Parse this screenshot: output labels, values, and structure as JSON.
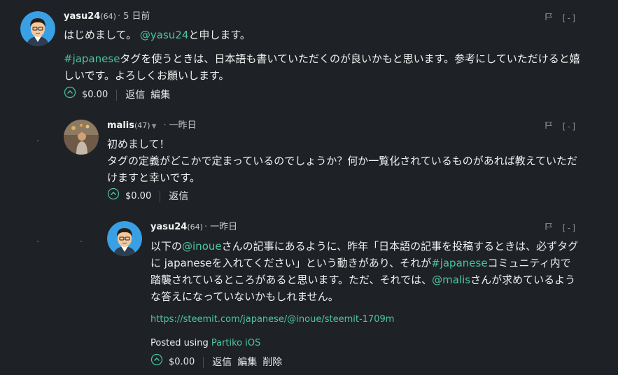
{
  "comments": [
    {
      "author": "yasu24",
      "reputation": "(64)",
      "separator": "·",
      "time": "5 日前",
      "collapse": "[-]",
      "body": {
        "greeting_text": "はじめまして。",
        "mention": "@yasu24",
        "greeting_suffix": "と申します。",
        "tag": "#japanese",
        "line_text": "タグを使うときは、日本語も書いていただくのが良いかもと思います。参考にしていただけると嬉しいです。よろしくお願いします。"
      },
      "payout": "$0.00",
      "actions": [
        "返信",
        "編集"
      ]
    },
    {
      "author": "malis",
      "reputation": "(47)",
      "separator": "·",
      "time": "一昨日",
      "collapse": "[-]",
      "body": {
        "line1": "初めまして！",
        "line2": "タグの定義がどこかで定まっているのでしょうか？何か一覧化されているものがあれば教えていただけますと幸いです。"
      },
      "payout": "$0.00",
      "actions": [
        "返信"
      ]
    },
    {
      "author": "yasu24",
      "reputation": "(64)",
      "separator": "·",
      "time": "一昨日",
      "collapse": "[-]",
      "body": {
        "text1": "以下の",
        "mention1": "@inoue",
        "text2": "さんの記事にあるように、昨年「日本語の記事を投稿するときは、必ずタグに japaneseを入れてください」という動きがあり、それが",
        "tag": "#japanese",
        "text3": "コミュニティ内で踏襲されているところがあると思います。ただ、それでは、",
        "mention2": "@malis",
        "text4": "さんが求めているような答えになっていないかもしれません。",
        "link": "https://steemit.com/japanese/@inoue/steemit-1709m",
        "posted_prefix": "Posted using",
        "posted_app": "Partiko iOS"
      },
      "payout": "$0.00",
      "actions": [
        "返信",
        "編集",
        "削除"
      ]
    }
  ],
  "colors": {
    "background": "#1e2226",
    "accent": "#4ac69e",
    "muted": "#8a8f94"
  },
  "icons": [
    "avatar-cartoon",
    "avatar-photo",
    "flag-icon",
    "upvote-icon",
    "caret-down-icon"
  ]
}
